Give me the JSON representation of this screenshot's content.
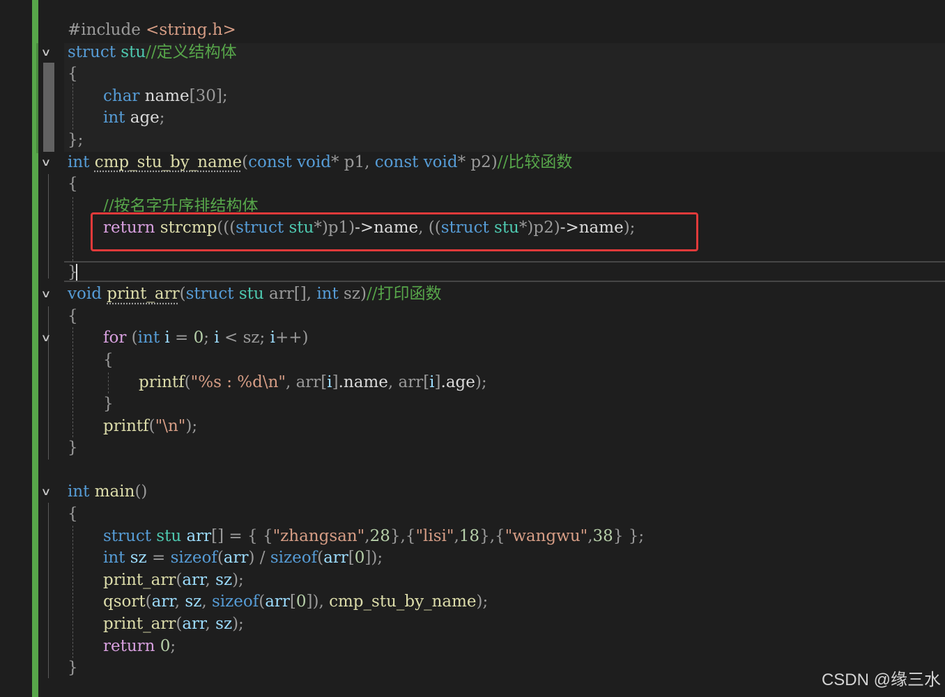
{
  "code_lines": [
    {
      "tokens": [
        {
          "t": "#include ",
          "c": "pre"
        },
        {
          "t": "<string.h>",
          "c": "str"
        }
      ]
    },
    {
      "fold": true,
      "tokens": [
        {
          "t": "struct ",
          "c": "kw"
        },
        {
          "t": "stu",
          "c": "typ"
        },
        {
          "t": "//定义结构体",
          "c": "cm"
        }
      ]
    },
    {
      "tokens": [
        {
          "t": "{",
          "c": "par"
        }
      ]
    },
    {
      "indent": 1,
      "tokens": [
        {
          "t": "char ",
          "c": "kw"
        },
        {
          "t": "name",
          "c": "mem"
        },
        {
          "t": "[30]",
          "c": "par"
        },
        {
          "t": ";",
          "c": "par"
        }
      ]
    },
    {
      "indent": 1,
      "tokens": [
        {
          "t": "int ",
          "c": "kw"
        },
        {
          "t": "age",
          "c": "mem"
        },
        {
          "t": ";",
          "c": "par"
        }
      ]
    },
    {
      "tokens": [
        {
          "t": "};",
          "c": "par"
        }
      ]
    },
    {
      "fold": true,
      "tokens": [
        {
          "t": "int ",
          "c": "kw"
        },
        {
          "t": "cmp_stu_by_name",
          "c": "fn",
          "sq": true
        },
        {
          "t": "(",
          "c": "par"
        },
        {
          "t": "const ",
          "c": "kw"
        },
        {
          "t": "void",
          "c": "kw"
        },
        {
          "t": "* p1, ",
          "c": "par"
        },
        {
          "t": "const ",
          "c": "kw"
        },
        {
          "t": "void",
          "c": "kw"
        },
        {
          "t": "* p2)",
          "c": "par"
        },
        {
          "t": "//比较函数",
          "c": "cm"
        }
      ]
    },
    {
      "tokens": [
        {
          "t": "{",
          "c": "par"
        }
      ]
    },
    {
      "indent": 1,
      "clip": true,
      "tokens": [
        {
          "t": "//按名字升序排结构体",
          "c": "cm"
        }
      ]
    },
    {
      "indent": 1,
      "tokens": [
        {
          "t": "return ",
          "c": "ctl"
        },
        {
          "t": "strcmp",
          "c": "fn"
        },
        {
          "t": "(((",
          "c": "par"
        },
        {
          "t": "struct ",
          "c": "kw"
        },
        {
          "t": "stu",
          "c": "typ"
        },
        {
          "t": "*)p1)",
          "c": "par"
        },
        {
          "t": "->name",
          "c": "mem"
        },
        {
          "t": ", ((",
          "c": "par"
        },
        {
          "t": "struct ",
          "c": "kw"
        },
        {
          "t": "stu",
          "c": "typ"
        },
        {
          "t": "*)p2)",
          "c": "par"
        },
        {
          "t": "->name",
          "c": "mem"
        },
        {
          "t": ");",
          "c": "par"
        }
      ]
    },
    {
      "tokens": []
    },
    {
      "tokens": [
        {
          "t": "}",
          "c": "par"
        }
      ]
    },
    {
      "fold": true,
      "tokens": [
        {
          "t": "void ",
          "c": "kw"
        },
        {
          "t": "print_arr",
          "c": "fn",
          "sq": true
        },
        {
          "t": "(",
          "c": "par"
        },
        {
          "t": "struct ",
          "c": "kw"
        },
        {
          "t": "stu ",
          "c": "typ"
        },
        {
          "t": "arr[], ",
          "c": "par"
        },
        {
          "t": "int ",
          "c": "kw"
        },
        {
          "t": "sz)",
          "c": "par"
        },
        {
          "t": "//打印函数",
          "c": "cm"
        }
      ]
    },
    {
      "tokens": [
        {
          "t": "{",
          "c": "par"
        }
      ]
    },
    {
      "fold": true,
      "indent": 1,
      "tokens": [
        {
          "t": "for ",
          "c": "ctl"
        },
        {
          "t": "(",
          "c": "par"
        },
        {
          "t": "int ",
          "c": "kw"
        },
        {
          "t": "i",
          "c": "var"
        },
        {
          "t": " = ",
          "c": "par"
        },
        {
          "t": "0",
          "c": "num"
        },
        {
          "t": "; ",
          "c": "par"
        },
        {
          "t": "i",
          "c": "var"
        },
        {
          "t": " < sz; ",
          "c": "par"
        },
        {
          "t": "i",
          "c": "var"
        },
        {
          "t": "++)",
          "c": "par"
        }
      ]
    },
    {
      "indent": 1,
      "tokens": [
        {
          "t": "{",
          "c": "par"
        }
      ]
    },
    {
      "indent": 2,
      "tokens": [
        {
          "t": "printf",
          "c": "fn"
        },
        {
          "t": "(",
          "c": "par"
        },
        {
          "t": "\"%s : %d\\n\"",
          "c": "str"
        },
        {
          "t": ", arr[",
          "c": "par"
        },
        {
          "t": "i",
          "c": "var"
        },
        {
          "t": "]",
          "c": "par"
        },
        {
          "t": ".name",
          "c": "mem"
        },
        {
          "t": ", arr[",
          "c": "par"
        },
        {
          "t": "i",
          "c": "var"
        },
        {
          "t": "]",
          "c": "par"
        },
        {
          "t": ".age",
          "c": "mem"
        },
        {
          "t": ");",
          "c": "par"
        }
      ]
    },
    {
      "indent": 1,
      "tokens": [
        {
          "t": "}",
          "c": "par"
        }
      ]
    },
    {
      "indent": 1,
      "tokens": [
        {
          "t": "printf",
          "c": "fn"
        },
        {
          "t": "(",
          "c": "par"
        },
        {
          "t": "\"\\n\"",
          "c": "str"
        },
        {
          "t": ");",
          "c": "par"
        }
      ]
    },
    {
      "tokens": [
        {
          "t": "}",
          "c": "par"
        }
      ]
    },
    {
      "tokens": []
    },
    {
      "fold": true,
      "tokens": [
        {
          "t": "int ",
          "c": "kw"
        },
        {
          "t": "main",
          "c": "fn"
        },
        {
          "t": "()",
          "c": "par"
        }
      ]
    },
    {
      "tokens": [
        {
          "t": "{",
          "c": "par"
        }
      ]
    },
    {
      "indent": 1,
      "tokens": [
        {
          "t": "struct ",
          "c": "kw"
        },
        {
          "t": "stu ",
          "c": "typ"
        },
        {
          "t": "arr",
          "c": "var"
        },
        {
          "t": "[] = { {",
          "c": "par"
        },
        {
          "t": "\"zhangsan\"",
          "c": "str"
        },
        {
          "t": ",",
          "c": "par"
        },
        {
          "t": "28",
          "c": "num"
        },
        {
          "t": "},{",
          "c": "par"
        },
        {
          "t": "\"lisi\"",
          "c": "str"
        },
        {
          "t": ",",
          "c": "par"
        },
        {
          "t": "18",
          "c": "num"
        },
        {
          "t": "},{",
          "c": "par"
        },
        {
          "t": "\"wangwu\"",
          "c": "str"
        },
        {
          "t": ",",
          "c": "par"
        },
        {
          "t": "38",
          "c": "num"
        },
        {
          "t": "} };",
          "c": "par"
        }
      ]
    },
    {
      "indent": 1,
      "tokens": [
        {
          "t": "int ",
          "c": "kw"
        },
        {
          "t": "sz",
          "c": "var"
        },
        {
          "t": " = ",
          "c": "par"
        },
        {
          "t": "sizeof",
          "c": "kw"
        },
        {
          "t": "(",
          "c": "par"
        },
        {
          "t": "arr",
          "c": "var"
        },
        {
          "t": ") / ",
          "c": "par"
        },
        {
          "t": "sizeof",
          "c": "kw"
        },
        {
          "t": "(",
          "c": "par"
        },
        {
          "t": "arr",
          "c": "var"
        },
        {
          "t": "[",
          "c": "par"
        },
        {
          "t": "0",
          "c": "num"
        },
        {
          "t": "]);",
          "c": "par"
        }
      ]
    },
    {
      "indent": 1,
      "tokens": [
        {
          "t": "print_arr",
          "c": "fn"
        },
        {
          "t": "(",
          "c": "par"
        },
        {
          "t": "arr",
          "c": "var"
        },
        {
          "t": ", ",
          "c": "par"
        },
        {
          "t": "sz",
          "c": "var"
        },
        {
          "t": ");",
          "c": "par"
        }
      ]
    },
    {
      "indent": 1,
      "tokens": [
        {
          "t": "qsort",
          "c": "fn"
        },
        {
          "t": "(",
          "c": "par"
        },
        {
          "t": "arr",
          "c": "var"
        },
        {
          "t": ", ",
          "c": "par"
        },
        {
          "t": "sz",
          "c": "var"
        },
        {
          "t": ", ",
          "c": "par"
        },
        {
          "t": "sizeof",
          "c": "kw"
        },
        {
          "t": "(",
          "c": "par"
        },
        {
          "t": "arr",
          "c": "var"
        },
        {
          "t": "[",
          "c": "par"
        },
        {
          "t": "0",
          "c": "num"
        },
        {
          "t": "]), ",
          "c": "par"
        },
        {
          "t": "cmp_stu_by_name",
          "c": "fn"
        },
        {
          "t": ");",
          "c": "par"
        }
      ]
    },
    {
      "indent": 1,
      "tokens": [
        {
          "t": "print_arr",
          "c": "fn"
        },
        {
          "t": "(",
          "c": "par"
        },
        {
          "t": "arr",
          "c": "var"
        },
        {
          "t": ", ",
          "c": "par"
        },
        {
          "t": "sz",
          "c": "var"
        },
        {
          "t": ");",
          "c": "par"
        }
      ]
    },
    {
      "indent": 1,
      "tokens": [
        {
          "t": "return ",
          "c": "ctl"
        },
        {
          "t": "0",
          "c": "num"
        },
        {
          "t": ";",
          "c": "par"
        }
      ]
    },
    {
      "tokens": [
        {
          "t": "}",
          "c": "par"
        }
      ]
    }
  ],
  "watermark": "CSDN @缘三水",
  "colors": {
    "background": "#1e1e1e",
    "keyword": "#569cd6",
    "control": "#d8a0df",
    "function": "#dcdcaa",
    "string": "#d69d85",
    "comment": "#57a64a",
    "highlight_box": "#e03a3a",
    "change_bar": "#57a64a"
  }
}
